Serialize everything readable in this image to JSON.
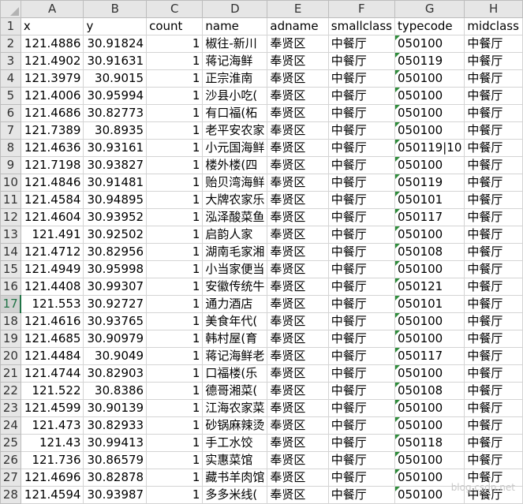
{
  "columns": [
    "A",
    "B",
    "C",
    "D",
    "E",
    "F",
    "G",
    "H"
  ],
  "header_row": {
    "num": "1",
    "cells": [
      "x",
      "y",
      "count",
      "name",
      "adname",
      "smallclass",
      "typecode",
      "midclass"
    ]
  },
  "selected_row": "17",
  "rows": [
    {
      "num": "2",
      "x": "121.4886",
      "y": "30.91824",
      "count": "1",
      "name": "椒往-新川",
      "adname": "奉贤区",
      "smallclass": "中餐厅",
      "typecode": "050100",
      "midclass": "中餐厅"
    },
    {
      "num": "3",
      "x": "121.4902",
      "y": "30.91631",
      "count": "1",
      "name": "蒋记海鲜",
      "adname": "奉贤区",
      "smallclass": "中餐厅",
      "typecode": "050119",
      "midclass": "中餐厅"
    },
    {
      "num": "4",
      "x": "121.3979",
      "y": "30.9015",
      "count": "1",
      "name": "正宗淮南",
      "adname": "奉贤区",
      "smallclass": "中餐厅",
      "typecode": "050100",
      "midclass": "中餐厅"
    },
    {
      "num": "5",
      "x": "121.4006",
      "y": "30.95994",
      "count": "1",
      "name": "沙县小吃(",
      "adname": "奉贤区",
      "smallclass": "中餐厅",
      "typecode": "050100",
      "midclass": "中餐厅"
    },
    {
      "num": "6",
      "x": "121.4686",
      "y": "30.82773",
      "count": "1",
      "name": "有口福(柘",
      "adname": "奉贤区",
      "smallclass": "中餐厅",
      "typecode": "050100",
      "midclass": "中餐厅"
    },
    {
      "num": "7",
      "x": "121.7389",
      "y": "30.8935",
      "count": "1",
      "name": "老平安农家",
      "adname": "奉贤区",
      "smallclass": "中餐厅",
      "typecode": "050100",
      "midclass": "中餐厅"
    },
    {
      "num": "8",
      "x": "121.4636",
      "y": "30.93161",
      "count": "1",
      "name": "小元国海鲜",
      "adname": "奉贤区",
      "smallclass": "中餐厅",
      "typecode": "050119|10",
      "midclass": "中餐厅"
    },
    {
      "num": "9",
      "x": "121.7198",
      "y": "30.93827",
      "count": "1",
      "name": "楼外楼(四",
      "adname": "奉贤区",
      "smallclass": "中餐厅",
      "typecode": "050100",
      "midclass": "中餐厅"
    },
    {
      "num": "10",
      "x": "121.4846",
      "y": "30.91481",
      "count": "1",
      "name": "贻贝湾海鲜",
      "adname": "奉贤区",
      "smallclass": "中餐厅",
      "typecode": "050119",
      "midclass": "中餐厅"
    },
    {
      "num": "11",
      "x": "121.4584",
      "y": "30.94895",
      "count": "1",
      "name": "大牌农家乐",
      "adname": "奉贤区",
      "smallclass": "中餐厅",
      "typecode": "050101",
      "midclass": "中餐厅"
    },
    {
      "num": "12",
      "x": "121.4604",
      "y": "30.93952",
      "count": "1",
      "name": "泓泽酸菜鱼",
      "adname": "奉贤区",
      "smallclass": "中餐厅",
      "typecode": "050117",
      "midclass": "中餐厅"
    },
    {
      "num": "13",
      "x": "121.491",
      "y": "30.92502",
      "count": "1",
      "name": "启韵人家",
      "adname": "奉贤区",
      "smallclass": "中餐厅",
      "typecode": "050100",
      "midclass": "中餐厅"
    },
    {
      "num": "14",
      "x": "121.4712",
      "y": "30.82956",
      "count": "1",
      "name": "湖南毛家湘",
      "adname": "奉贤区",
      "smallclass": "中餐厅",
      "typecode": "050108",
      "midclass": "中餐厅"
    },
    {
      "num": "15",
      "x": "121.4949",
      "y": "30.95998",
      "count": "1",
      "name": "小当家便当",
      "adname": "奉贤区",
      "smallclass": "中餐厅",
      "typecode": "050100",
      "midclass": "中餐厅"
    },
    {
      "num": "16",
      "x": "121.4408",
      "y": "30.99307",
      "count": "1",
      "name": "安徽传统牛",
      "adname": "奉贤区",
      "smallclass": "中餐厅",
      "typecode": "050121",
      "midclass": "中餐厅"
    },
    {
      "num": "17",
      "x": "121.553",
      "y": "30.92727",
      "count": "1",
      "name": "通力酒店",
      "adname": "奉贤区",
      "smallclass": "中餐厅",
      "typecode": "050101",
      "midclass": "中餐厅"
    },
    {
      "num": "18",
      "x": "121.4616",
      "y": "30.93765",
      "count": "1",
      "name": "美食年代(",
      "adname": "奉贤区",
      "smallclass": "中餐厅",
      "typecode": "050100",
      "midclass": "中餐厅"
    },
    {
      "num": "19",
      "x": "121.4685",
      "y": "30.90979",
      "count": "1",
      "name": "韩村屋(育",
      "adname": "奉贤区",
      "smallclass": "中餐厅",
      "typecode": "050100",
      "midclass": "中餐厅"
    },
    {
      "num": "20",
      "x": "121.4484",
      "y": "30.9049",
      "count": "1",
      "name": "蒋记海鲜老",
      "adname": "奉贤区",
      "smallclass": "中餐厅",
      "typecode": "050117",
      "midclass": "中餐厅"
    },
    {
      "num": "21",
      "x": "121.4744",
      "y": "30.82903",
      "count": "1",
      "name": "口福楼(乐",
      "adname": "奉贤区",
      "smallclass": "中餐厅",
      "typecode": "050100",
      "midclass": "中餐厅"
    },
    {
      "num": "22",
      "x": "121.522",
      "y": "30.8386",
      "count": "1",
      "name": "德哥湘菜(",
      "adname": "奉贤区",
      "smallclass": "中餐厅",
      "typecode": "050108",
      "midclass": "中餐厅"
    },
    {
      "num": "23",
      "x": "121.4599",
      "y": "30.90139",
      "count": "1",
      "name": "江海农家菜",
      "adname": "奉贤区",
      "smallclass": "中餐厅",
      "typecode": "050100",
      "midclass": "中餐厅"
    },
    {
      "num": "24",
      "x": "121.473",
      "y": "30.82933",
      "count": "1",
      "name": "砂锅麻辣烫",
      "adname": "奉贤区",
      "smallclass": "中餐厅",
      "typecode": "050100",
      "midclass": "中餐厅"
    },
    {
      "num": "25",
      "x": "121.43",
      "y": "30.99413",
      "count": "1",
      "name": "手工水饺",
      "adname": "奉贤区",
      "smallclass": "中餐厅",
      "typecode": "050118",
      "midclass": "中餐厅"
    },
    {
      "num": "26",
      "x": "121.736",
      "y": "30.86579",
      "count": "1",
      "name": "实惠菜馆",
      "adname": "奉贤区",
      "smallclass": "中餐厅",
      "typecode": "050100",
      "midclass": "中餐厅"
    },
    {
      "num": "27",
      "x": "121.4696",
      "y": "30.82878",
      "count": "1",
      "name": "藏书羊肉馆",
      "adname": "奉贤区",
      "smallclass": "中餐厅",
      "typecode": "050100",
      "midclass": "中餐厅"
    },
    {
      "num": "28",
      "x": "121.4594",
      "y": "30.93987",
      "count": "1",
      "name": "多多米线(",
      "adname": "奉贤区",
      "smallclass": "中餐厅",
      "typecode": "050100",
      "midclass": "中餐厅"
    }
  ],
  "watermark": "blog.csdn.net"
}
